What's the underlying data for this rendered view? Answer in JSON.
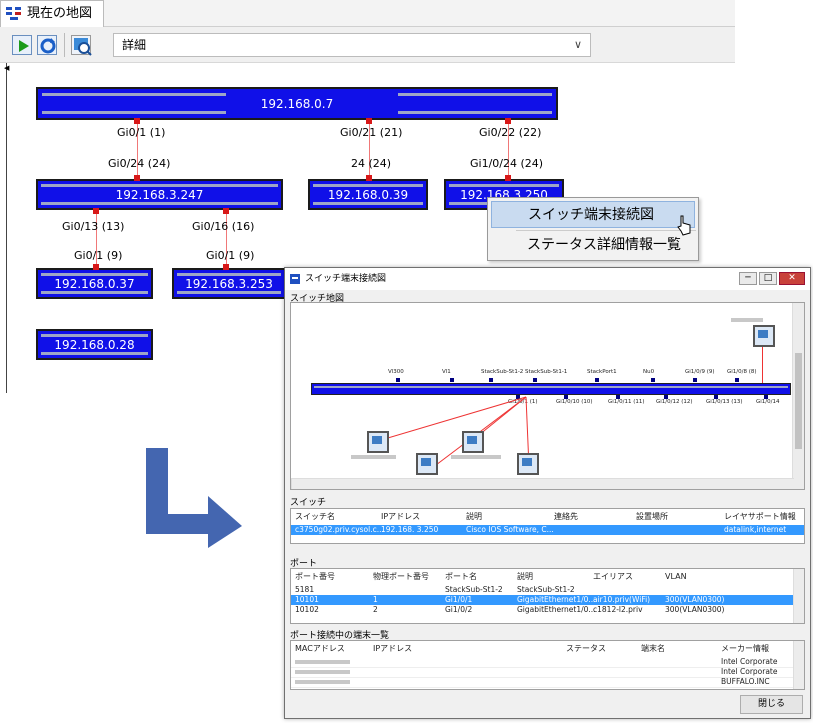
{
  "tab": {
    "label": "現在の地図"
  },
  "toolbar": {
    "view_select": "詳細",
    "view_arrow": "∨"
  },
  "map": {
    "switches": {
      "core": "192.168.0.7",
      "s247": "192.168.3.247",
      "s39": "192.168.0.39",
      "s250": "192.168.3.250",
      "s37": "192.168.0.37",
      "s253": "192.168.3.253",
      "s28": "192.168.0.28"
    },
    "ports": {
      "p1": "Gi0/1 (1)",
      "p2": "Gi0/21 (21)",
      "p3": "Gi0/22 (22)",
      "p4": "Gi0/24 (24)",
      "p5": "24 (24)",
      "p6": "Gi1/0/24 (24)",
      "p7": "Gi0/13 (13)",
      "p8": "Gi0/16 (16)",
      "p9": "Gi0/1 (9)",
      "p10": "Gi0/1 (9)"
    }
  },
  "context_menu": {
    "item1": "スイッチ端末接続図",
    "item2": "ステータス詳細情報一覧"
  },
  "dialog": {
    "title": "スイッチ端末接続図",
    "map_section": "スイッチ地図",
    "mini_ports": [
      "Vl300",
      "Vl1",
      "StackSub-St1-2",
      "StackSub-St1-1",
      "StackPort1",
      "Nu0",
      "Gi1/0/9 (9)",
      "Gi1/0/8 (8)"
    ],
    "mini_ports2": [
      "Gi1/0/1 (1)",
      "Gi1/0/10 (10)",
      "Gi1/0/11 (11)",
      "Gi1/0/12 (12)",
      "Gi1/0/13 (13)",
      "Gi1/0/14"
    ],
    "switch_section": "スイッチ",
    "switch_headers": [
      "スイッチ名",
      "IPアドレス",
      "説明",
      "連絡先",
      "設置場所",
      "レイヤサポート情報"
    ],
    "switch_row": [
      "c3750g02.priv.cysol.c...",
      "192.168. 3.250",
      "Cisco IOS Software, C...",
      "",
      "",
      "datalink,internet"
    ],
    "port_section": "ポート",
    "port_headers": [
      "ポート番号",
      "物理ポート番号",
      "ポート名",
      "説明",
      "エイリアス",
      "VLAN"
    ],
    "port_rows": [
      [
        "5181",
        "",
        "StackSub-St1-2",
        "StackSub-St1-2",
        "",
        ""
      ],
      [
        "10101",
        "1",
        "Gi1/0/1",
        "GigabitEthernet1/0...",
        "air10.priv(WiFi)",
        "300(VLAN0300)"
      ],
      [
        "10102",
        "2",
        "Gi1/0/2",
        "GigabitEthernet1/0...",
        "c1812-l2.priv",
        "300(VLAN0300)"
      ]
    ],
    "terminal_section": "ポート接続中の端末一覧",
    "terminal_headers": [
      "MACアドレス",
      "IPアドレス",
      "ステータス",
      "端末名",
      "メーカー情報"
    ],
    "terminal_vendors": [
      "Intel Corporate",
      "Intel Corporate",
      "BUFFALO.INC"
    ],
    "close_label": "閉じる"
  },
  "colors": {
    "switch_fill": "#1010e8",
    "port": "#d81818",
    "link": "#f07878",
    "arrow": "#4466b0",
    "selection": "#3399ff"
  }
}
